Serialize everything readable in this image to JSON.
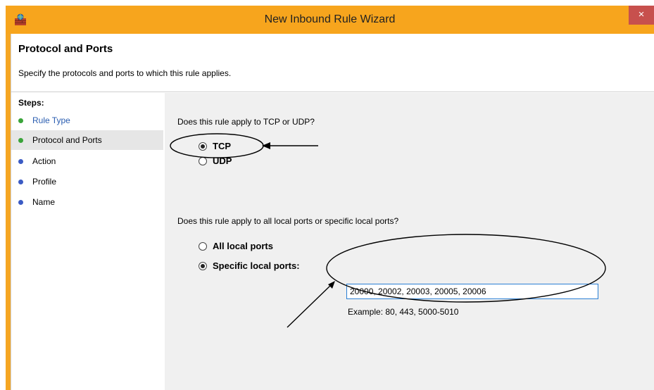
{
  "window": {
    "title": "New Inbound Rule Wizard",
    "close_label": "×",
    "accent_color": "#f7a51d"
  },
  "header": {
    "title": "Protocol and Ports",
    "description": "Specify the protocols and ports to which this rule applies."
  },
  "steps": {
    "title": "Steps:",
    "items": [
      {
        "label": "Rule Type",
        "dot_color": "#3aa43a"
      },
      {
        "label": "Protocol and Ports",
        "dot_color": "#3aa43a"
      },
      {
        "label": "Action",
        "dot_color": "#3b5bc4"
      },
      {
        "label": "Profile",
        "dot_color": "#3b5bc4"
      },
      {
        "label": "Name",
        "dot_color": "#3b5bc4"
      }
    ]
  },
  "protocol": {
    "question": "Does this rule apply to TCP or UDP?",
    "options": [
      {
        "label": "TCP",
        "selected": true
      },
      {
        "label": "UDP",
        "selected": false
      }
    ]
  },
  "ports": {
    "question": "Does this rule apply to all local ports or specific local ports?",
    "options": [
      {
        "label": "All local ports",
        "selected": false
      },
      {
        "label": "Specific local ports:",
        "selected": true
      }
    ],
    "value": "20000, 20002, 20003, 20005, 20006",
    "example": "Example: 80, 443, 5000-5010"
  }
}
